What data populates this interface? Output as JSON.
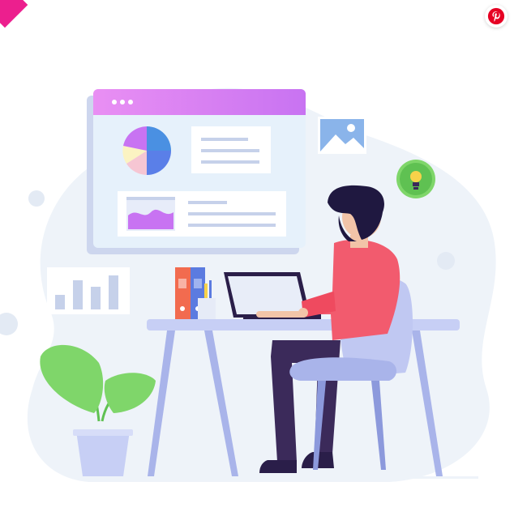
{
  "illustration": {
    "subject": "person-working-at-desk",
    "icons": [
      "pinterest-icon",
      "image-icon",
      "lightbulb-icon",
      "pie-chart-icon",
      "bar-chart-icon",
      "area-chart-icon"
    ]
  },
  "colors": {
    "accent_gradient_start": "#e879f0",
    "accent_gradient_end": "#c86df0",
    "pinterest_red": "#e60023",
    "shirt": "#f25b6e",
    "pants": "#3b2a5a",
    "desk": "#b8c4ef",
    "plant": "#7fd66a",
    "background_blob": "#eef3f9"
  }
}
